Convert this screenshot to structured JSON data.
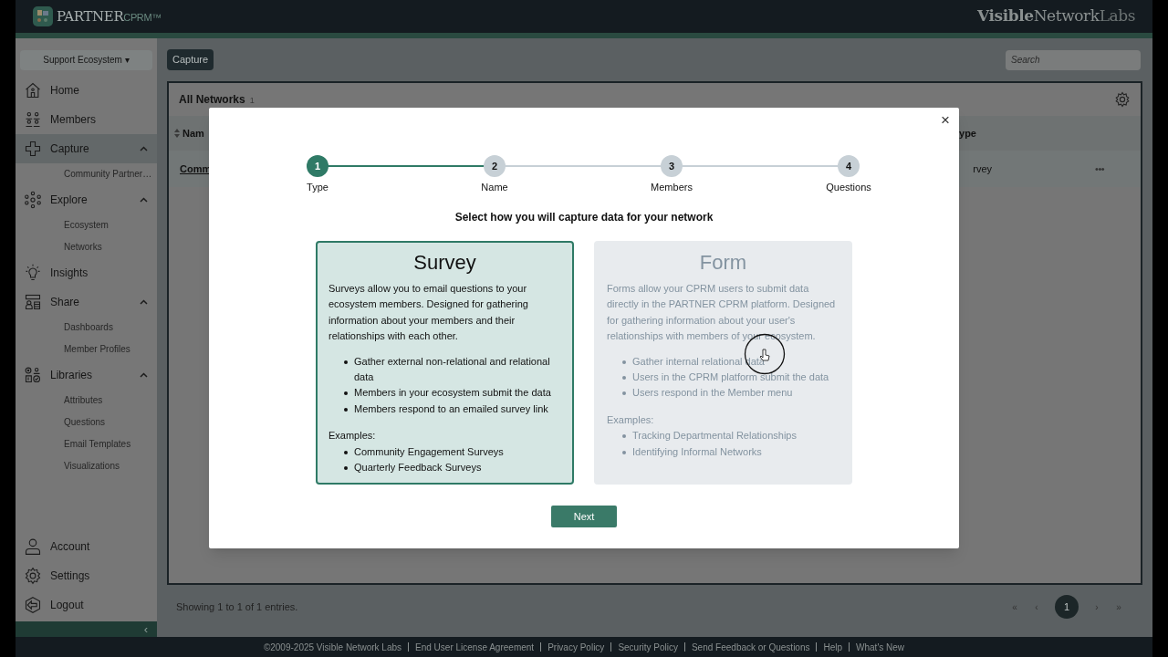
{
  "header": {
    "product": "PARTNER",
    "product_suffix": "CPRM™",
    "company": [
      "Visible",
      "Network",
      "Labs"
    ]
  },
  "sidebar": {
    "ecosystem": "Support Ecosystem ▾",
    "items": [
      {
        "kind": "home",
        "label": "Home",
        "selected": false
      },
      {
        "kind": "members",
        "label": "Members",
        "selected": false
      },
      {
        "kind": "capture",
        "label": "Capture",
        "selected": true,
        "expanded": true,
        "children": [
          {
            "label": "Community Partner…"
          }
        ]
      },
      {
        "kind": "explore",
        "label": "Explore",
        "selected": false,
        "expanded": true,
        "children": [
          {
            "label": "Ecosystem"
          },
          {
            "label": "Networks"
          }
        ]
      },
      {
        "kind": "insights",
        "label": "Insights",
        "selected": false
      },
      {
        "kind": "share",
        "label": "Share",
        "selected": false,
        "expanded": true,
        "children": [
          {
            "label": "Dashboards"
          },
          {
            "label": "Member Profiles"
          }
        ]
      },
      {
        "kind": "libraries",
        "label": "Libraries",
        "selected": false,
        "expanded": true,
        "children": [
          {
            "label": "Attributes"
          },
          {
            "label": "Questions"
          },
          {
            "label": "Email Templates"
          },
          {
            "label": "Visualizations"
          }
        ]
      }
    ],
    "bottom_items": [
      {
        "kind": "account",
        "label": "Account"
      },
      {
        "kind": "settings",
        "label": "Settings"
      },
      {
        "kind": "logout",
        "label": "Logout"
      }
    ],
    "collapse": "‹"
  },
  "main": {
    "breadcrumb": "Capture",
    "search": {
      "placeholder": "Search"
    },
    "card": {
      "title": "All Networks",
      "count": "1"
    },
    "columns": [
      "Nam",
      "ype"
    ],
    "rows": [
      {
        "name": "Comm",
        "type": "rvey",
        "menu": "•••"
      }
    ],
    "summary": "Showing 1 to 1 of 1 entries.",
    "pagination": [
      {
        "label": "«",
        "selected": false
      },
      {
        "label": "‹",
        "selected": false
      },
      {
        "label": "1",
        "selected": true
      },
      {
        "label": "›",
        "selected": false
      },
      {
        "label": "»",
        "selected": false
      }
    ]
  },
  "modal": {
    "close": "×",
    "steps": [
      {
        "number": "1",
        "label": "Type",
        "selected": true
      },
      {
        "number": "2",
        "label": "Name",
        "selected": false
      },
      {
        "number": "3",
        "label": "Members",
        "selected": false
      },
      {
        "number": "4",
        "label": "Questions",
        "selected": false
      }
    ],
    "heading": "Select how you will capture data for your network",
    "options": [
      {
        "title": "Survey",
        "selected": true,
        "description": "Surveys allow you to email questions to your ecosystem members. Designed for gathering information about your members and their relationships with each other.",
        "bullets": [
          "Gather external non-relational and relational data",
          "Members in your ecosystem submit the data",
          "Members respond to an emailed survey link"
        ],
        "examples_label": "Examples:",
        "examples": [
          "Community Engagement Surveys",
          "Quarterly Feedback Surveys"
        ]
      },
      {
        "title": "Form",
        "selected": false,
        "description": "Forms allow your CPRM users to submit data directly in the PARTNER CPRM platform. Designed for gathering information about your user's relationships with members of your ecosystem.",
        "bullets": [
          "Gather internal relational data",
          "Users in the CPRM platform submit the data",
          "Users respond in the Member menu"
        ],
        "examples_label": "Examples:",
        "examples": [
          "Tracking Departmental Relationships",
          "Identifying Informal Networks"
        ]
      }
    ],
    "next": "Next"
  },
  "footer": {
    "links": [
      "©2009-2025 Visible Network Labs",
      "End User License Agreement",
      "Privacy Policy",
      "Security Policy",
      "Send Feedback or Questions",
      "Help",
      "What's New"
    ]
  }
}
